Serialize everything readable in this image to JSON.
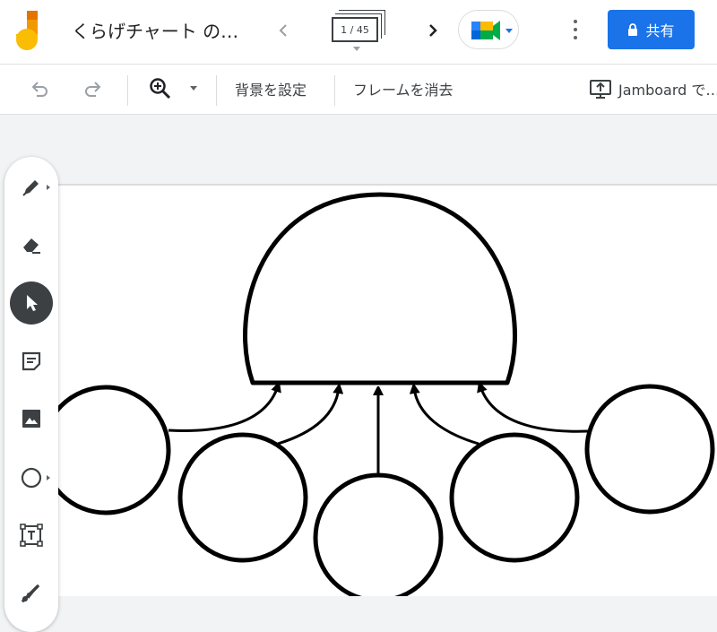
{
  "app": {
    "document_title": "くらげチャート の…",
    "frame_counter": "1 / 45",
    "share_label": "共有"
  },
  "toolbar": {
    "set_background": "背景を設定",
    "clear_frame": "フレームを消去",
    "present_label": "Jamboard で…"
  },
  "icons": {
    "logo": "jamboard-logo",
    "prev": "chevron-left-icon",
    "next": "chevron-right-icon",
    "meet": "google-meet-icon",
    "more": "more-vert-icon",
    "lock": "lock-icon",
    "undo": "undo-icon",
    "redo": "redo-icon",
    "zoom": "zoom-in-icon",
    "present": "present-to-screen-icon"
  },
  "tools": [
    {
      "name": "pen-tool",
      "icon": "pen-icon",
      "has_menu": true
    },
    {
      "name": "eraser-tool",
      "icon": "eraser-icon",
      "has_menu": false
    },
    {
      "name": "select-tool",
      "icon": "cursor-arrow-icon",
      "has_menu": false,
      "active": true
    },
    {
      "name": "sticky-note-tool",
      "icon": "sticky-note-icon",
      "has_menu": false
    },
    {
      "name": "image-tool",
      "icon": "image-icon",
      "has_menu": false
    },
    {
      "name": "shape-tool",
      "icon": "circle-icon",
      "has_menu": true
    },
    {
      "name": "text-box-tool",
      "icon": "text-box-icon",
      "has_menu": false
    },
    {
      "name": "laser-tool",
      "icon": "laser-pointer-icon",
      "has_menu": false
    }
  ],
  "colors": {
    "accent": "#1a73e8",
    "toolbar_text": "#3c4043",
    "canvas_bg": "#ffffff",
    "app_bg": "#f1f3f4",
    "logo_orange": "#f29900",
    "logo_yellow": "#fbbc04",
    "ink": "#000000"
  }
}
